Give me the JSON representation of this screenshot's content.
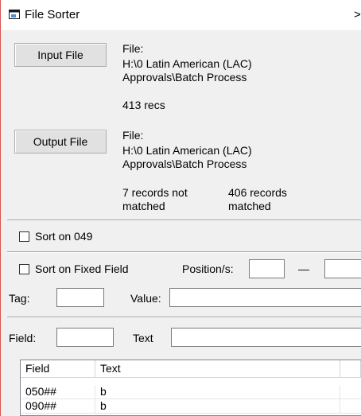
{
  "window": {
    "title": "File Sorter",
    "close_glyph": ">"
  },
  "input": {
    "button_label": "Input File",
    "file_label": "File:",
    "path_line1": "H:\\0 Latin American (LAC)",
    "path_line2": "Approvals\\Batch Process",
    "count": "413 recs"
  },
  "output": {
    "button_label": "Output File",
    "file_label": "File:",
    "path_line1": "H:\\0 Latin American (LAC)",
    "path_line2": "Approvals\\Batch Process",
    "not_matched_line1": "7 records not",
    "not_matched_line2": "matched",
    "matched_line1": "406 records",
    "matched_line2": "matched"
  },
  "sort049": {
    "label": "Sort on 049",
    "checked": false
  },
  "fixed_field": {
    "label": "Sort on Fixed Field",
    "checked": false,
    "position_label": "Position/s:",
    "position_from": "",
    "dash": "—",
    "position_to": "",
    "tag_label": "Tag:",
    "tag_value": "",
    "value_label": "Value:",
    "value_value": ""
  },
  "filter": {
    "field_label": "Field:",
    "field_value": "",
    "text_label": "Text",
    "text_value": ""
  },
  "table": {
    "columns": [
      "Field",
      "Text"
    ],
    "rows": [
      {
        "field": "050##",
        "text": "b"
      },
      {
        "field": "090##",
        "text": "b"
      }
    ]
  }
}
